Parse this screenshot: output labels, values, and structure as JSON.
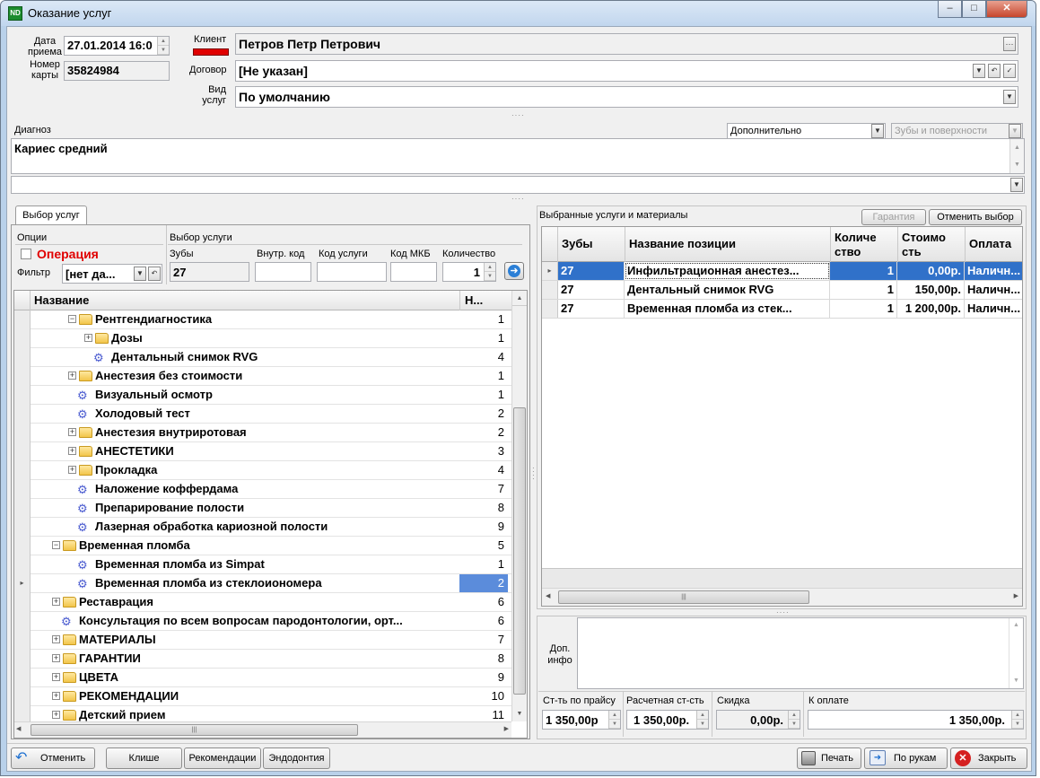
{
  "window": {
    "title": "Оказание услуг",
    "app_icon": "ND"
  },
  "header": {
    "date_label": "Дата приема",
    "date_value": "27.01.2014 16:0",
    "card_label": "Номер карты",
    "card_value": "35824984",
    "client_label": "Клиент",
    "client_color": "#e00000",
    "client_value": "Петров Петр Петрович",
    "contract_label": "Договор",
    "contract_value": "[Не указан]",
    "service_type_label": "Вид услуг",
    "service_type_value": "По умолчанию"
  },
  "diagnosis": {
    "label": "Диагноз",
    "extra_select": "Дополнительно",
    "teeth_select": "Зубы и поверхности",
    "value": "Кариес средний",
    "second_line": ""
  },
  "left_panel": {
    "tab": "Выбор услуг",
    "options_label": "Опции",
    "operation_label": "Операция",
    "filter_label": "Фильтр",
    "filter_value": "[нет да...",
    "select_service_label": "Выбор услуги",
    "teeth_label": "Зубы",
    "teeth_value": "27",
    "inner_code_label": "Внутр. код",
    "service_code_label": "Код услуги",
    "mkb_code_label": "Код МКБ",
    "quantity_label": "Количество",
    "quantity_value": "1",
    "tree_header_name": "Название",
    "tree_header_count": "Н...",
    "tree": [
      {
        "name": "Рентгендиагностика",
        "count": "1",
        "type": "folder",
        "level": 2,
        "exp": "−"
      },
      {
        "name": "Дозы",
        "count": "1",
        "type": "folder",
        "level": 3,
        "exp": "+"
      },
      {
        "name": "Дентальный снимок  RVG",
        "count": "4",
        "type": "item",
        "level": 3,
        "exp": ""
      },
      {
        "name": "Анестезия без стоимости",
        "count": "1",
        "type": "folder",
        "level": 2,
        "exp": "+"
      },
      {
        "name": "Визуальный осмотр",
        "count": "1",
        "type": "item",
        "level": 2,
        "exp": ""
      },
      {
        "name": "Холодовый тест",
        "count": "2",
        "type": "item",
        "level": 2,
        "exp": ""
      },
      {
        "name": "Анестезия внутриротовая",
        "count": "2",
        "type": "folder",
        "level": 2,
        "exp": "+"
      },
      {
        "name": "АНЕСТЕТИКИ",
        "count": "3",
        "type": "folder",
        "level": 2,
        "exp": "+"
      },
      {
        "name": "Прокладка",
        "count": "4",
        "type": "folder",
        "level": 2,
        "exp": "+"
      },
      {
        "name": "Наложение коффердама",
        "count": "7",
        "type": "item",
        "level": 2,
        "exp": ""
      },
      {
        "name": "Препарирование   полости",
        "count": "8",
        "type": "item",
        "level": 2,
        "exp": ""
      },
      {
        "name": "Лазерная обработка кариозной полости",
        "count": "9",
        "type": "item",
        "level": 2,
        "exp": ""
      },
      {
        "name": "Временная пломба",
        "count": "5",
        "type": "folder",
        "level": 1,
        "exp": "−"
      },
      {
        "name": "Временная пломба  из Simpat",
        "count": "1",
        "type": "item",
        "level": 2,
        "exp": ""
      },
      {
        "name": "Временная пломба  из стеклоиономера",
        "count": "2",
        "type": "item",
        "level": 2,
        "exp": "",
        "selected": true
      },
      {
        "name": "Реставрация",
        "count": "6",
        "type": "folder",
        "level": 1,
        "exp": "+"
      },
      {
        "name": "Консультация по всем вопросам пародонтологии, орт...",
        "count": "6",
        "type": "item",
        "level": 1,
        "exp": ""
      },
      {
        "name": "МАТЕРИАЛЫ",
        "count": "7",
        "type": "folder",
        "level": 1,
        "exp": "+"
      },
      {
        "name": "ГАРАНТИИ",
        "count": "8",
        "type": "folder",
        "level": 1,
        "exp": "+"
      },
      {
        "name": "ЦВЕТА",
        "count": "9",
        "type": "folder",
        "level": 1,
        "exp": "+"
      },
      {
        "name": "РЕКОМЕНДАЦИИ",
        "count": "10",
        "type": "folder",
        "level": 1,
        "exp": "+"
      },
      {
        "name": "Детский прием",
        "count": "11",
        "type": "folder",
        "level": 1,
        "exp": "+"
      }
    ]
  },
  "right_panel": {
    "title": "Выбранные услуги и материалы",
    "guarantee_button": "Гарантия",
    "cancel_selection_button": "Отменить выбор",
    "columns": [
      "Зубы",
      "Название позиции",
      "Количе ство",
      "Стоимо сть",
      "Оплата"
    ],
    "rows": [
      {
        "teeth": "27",
        "name": "Инфильтрационная анестез...",
        "qty": "1",
        "cost": "0,00р.",
        "payment": "Наличн..."
      },
      {
        "teeth": "27",
        "name": "Дентальный снимок  RVG",
        "qty": "1",
        "cost": "150,00р.",
        "payment": "Наличн..."
      },
      {
        "teeth": "27",
        "name": "Временная пломба  из стек...",
        "qty": "1",
        "cost": "1 200,00р.",
        "payment": "Наличн..."
      }
    ],
    "extra_info_label": "Доп. инфо",
    "price_list_label": "Ст-ть по прайсу",
    "price_list_value": "1 350,00р",
    "calc_label": "Расчетная ст-сть",
    "calc_value": "1 350,00р.",
    "discount_label": "Скидка",
    "discount_value": "0,00р.",
    "to_pay_label": "К оплате",
    "to_pay_value": "1 350,00р."
  },
  "footer": {
    "cancel": "Отменить",
    "cliche": "Клише",
    "recommendations": "Рекомендации",
    "endodontics": "Эндодонтия",
    "print": "Печать",
    "by_hand": "По рукам",
    "close": "Закрыть"
  }
}
